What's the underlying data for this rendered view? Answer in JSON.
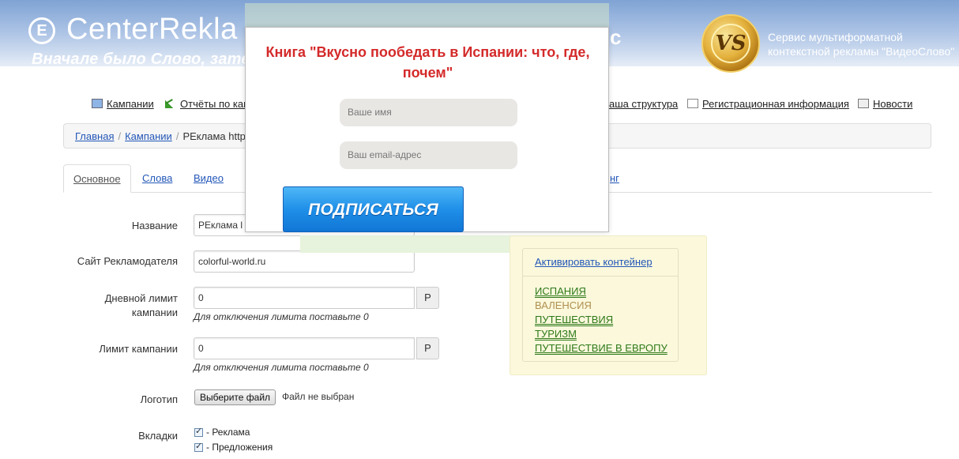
{
  "header": {
    "logo_letter": "E",
    "logo_text": "CenterRekla",
    "logo_tail": "c",
    "slogan": "Вначале было Слово, затем E",
    "service_line1": "Сервис мультиформатной",
    "service_line2": "контекстной рекламы \"ВидеоСлово\""
  },
  "nav": {
    "campaigns": "Кампании",
    "reports": "Отчёты по кам",
    "structure": "аша структура",
    "registration": "Регистрационная информация",
    "news": "Новости"
  },
  "breadcrumb": {
    "home": "Главная",
    "campaigns": "Кампании",
    "current": "РЕклама http"
  },
  "tabs": {
    "main": "Основное",
    "words": "Слова",
    "video": "Видео",
    "tail": "нг"
  },
  "form": {
    "name_label": "Название",
    "name_value": "РЕклама l",
    "site_label": "Сайт Рекламодателя",
    "site_value": "colorful-world.ru",
    "daily_label_1": "Дневной лимит",
    "daily_label_2": "кампании",
    "daily_value": "0",
    "currency": "Р",
    "limit_hint": "Для отключения лимита поставьте 0",
    "campaign_limit_label": "Лимит кампании",
    "campaign_limit_value": "0",
    "logo_label": "Логотип",
    "file_button": "Выберите файл",
    "file_status": "Файл не выбран",
    "tabs_label": "Вкладки",
    "tab_options": [
      "- Реклама",
      "- Предложения"
    ]
  },
  "container_panel": {
    "activate_link": "Активировать контейнер",
    "keywords": [
      "ИСПАНИЯ",
      "ВАЛЕНСИЯ",
      "ПУТЕШЕСТВИЯ",
      "ТУРИЗМ",
      "ПУТЕШЕСТВИЕ В ЕВРОПУ"
    ]
  },
  "popup": {
    "title": "Книга \"Вкусно пообедать в Испании: что, где, почем\"",
    "name_placeholder": "Ваше имя",
    "email_placeholder": "Ваш email-адрес",
    "subscribe": "ПОДПИСАТЬСЯ"
  },
  "colors": {
    "header_blue": "#7fa3d4",
    "popup_title_red": "#d42a2a",
    "button_blue": "#1f8fe8",
    "keyword_green": "#2e7a1a",
    "panel_bg": "#fbf8dc"
  }
}
